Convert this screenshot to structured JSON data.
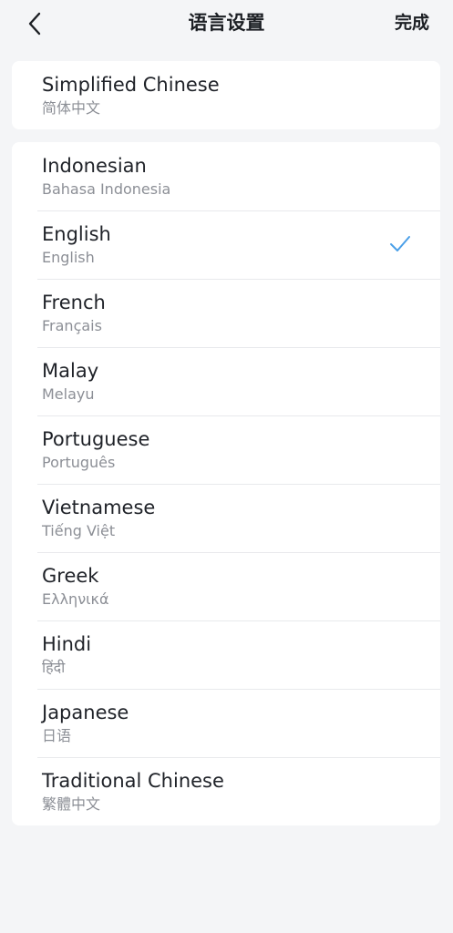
{
  "header": {
    "title": "语言设置",
    "done_label": "完成",
    "back_icon": "chevron-left-icon"
  },
  "current_language": {
    "name": "Simplified Chinese",
    "native": "简体中文"
  },
  "languages": [
    {
      "name": "Indonesian",
      "native": "Bahasa Indonesia",
      "selected": false
    },
    {
      "name": "English",
      "native": "English",
      "selected": true
    },
    {
      "name": "French",
      "native": "Français",
      "selected": false
    },
    {
      "name": "Malay",
      "native": "Melayu",
      "selected": false
    },
    {
      "name": "Portuguese",
      "native": "Português",
      "selected": false
    },
    {
      "name": "Vietnamese",
      "native": "Tiếng Việt",
      "selected": false
    },
    {
      "name": "Greek",
      "native": "Ελληνικά",
      "selected": false
    },
    {
      "name": "Hindi",
      "native": "हिंदी",
      "selected": false
    },
    {
      "name": "Japanese",
      "native": "日语",
      "selected": false
    },
    {
      "name": "Traditional Chinese",
      "native": "繁體中文",
      "selected": false
    }
  ],
  "colors": {
    "background": "#f4f5f7",
    "card": "#ffffff",
    "primary_text": "#1f2228",
    "secondary_text": "#8c8f96",
    "check": "#4a9fe8",
    "divider": "#e8e9ec"
  },
  "selected_icon": "checkmark-icon"
}
